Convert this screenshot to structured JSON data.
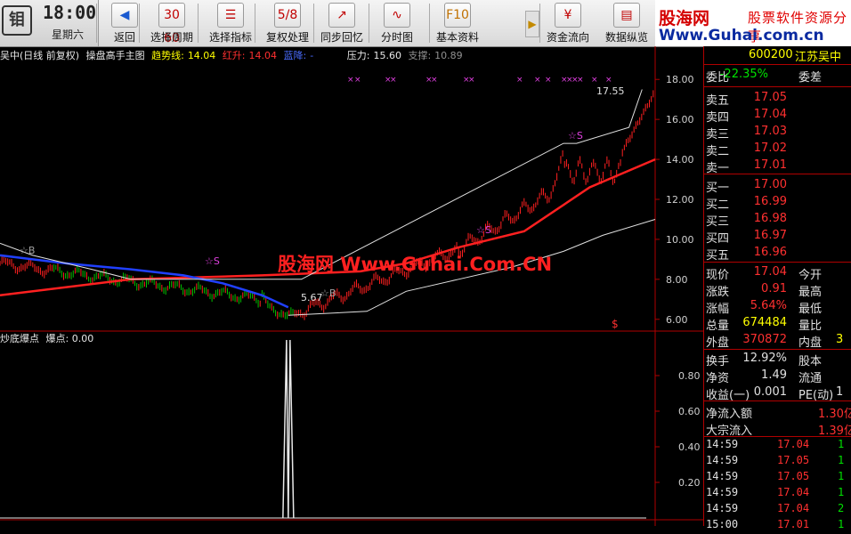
{
  "toolbar": {
    "clock_logo": "钼",
    "time": "18:00",
    "day": "星期六",
    "buttons": [
      {
        "label": "返回",
        "icon": "back-arrow-icon",
        "glyph": "◀"
      },
      {
        "label": "选择周期",
        "icon": "calendar-icon",
        "glyph": "30 60\n天"
      },
      {
        "label": "选择指标",
        "icon": "indicator-icon",
        "glyph": "☰"
      },
      {
        "label": "复权处理",
        "icon": "adjust-icon",
        "glyph": "5/8"
      },
      {
        "label": "同步回忆",
        "icon": "sync-chart-icon",
        "glyph": "↗"
      },
      {
        "label": "分时图",
        "icon": "intraday-icon",
        "glyph": "∿"
      },
      {
        "label": "基本资料",
        "icon": "f10-icon",
        "glyph": "F10"
      },
      {
        "label": "资金流向",
        "icon": "money-flow-icon",
        "glyph": "¥"
      },
      {
        "label": "数据纵览",
        "icon": "data-overview-icon",
        "glyph": "▤"
      }
    ]
  },
  "banner": {
    "title": "股海网",
    "slogan": "股票软件资源分享",
    "url": "Www.Guhai.com.cn"
  },
  "chart_header": {
    "name": "吴中(日线 前复权)",
    "indicator": "操盘高手主图",
    "trend_label": "趋势线:",
    "trend_value": "14.04",
    "red_label": "红升:",
    "red_value": "14.04",
    "blue_label": "蓝降:",
    "blue_value": "-",
    "press_label": "压力:",
    "press_value": "15.60",
    "support_label": "支撑:",
    "support_value": "10.89"
  },
  "watermark": "股海网 Www.Guhai.Com.CN",
  "annotations": {
    "high_price": "17.55",
    "low_price": "5.67",
    "signal_s": "☆S",
    "signal_b": "☆B",
    "dollar": "$"
  },
  "indicator_header": {
    "name": "炒底爆点",
    "label": "爆点:",
    "value": "0.00"
  },
  "chart_data": {
    "type": "line",
    "title": "",
    "main_axis": {
      "ticks": [
        "18.00",
        "16.00",
        "14.00",
        "12.00",
        "10.00",
        "8.00",
        "6.00"
      ],
      "ylim": [
        5.5,
        18.5
      ]
    },
    "sub_axis": {
      "ticks": [
        "0.80",
        "0.60",
        "0.40",
        "0.20"
      ],
      "ylim": [
        0,
        1
      ]
    },
    "series": [
      {
        "name": "趋势线",
        "color": "#ff2020",
        "x": [
          0,
          20,
          40,
          55,
          62,
          70,
          80,
          90,
          100
        ],
        "y": [
          7.2,
          8.0,
          8.2,
          8.4,
          8.8,
          9.6,
          10.4,
          12.6,
          14.0
        ]
      },
      {
        "name": "蓝降",
        "color": "#2040ff",
        "x": [
          0,
          10,
          20,
          28,
          34,
          40,
          44
        ],
        "y": [
          9.2,
          8.8,
          8.5,
          8.2,
          7.8,
          7.2,
          6.6
        ]
      },
      {
        "name": "压力",
        "color": "#e0e0e0",
        "x": [
          0,
          5,
          14,
          20,
          44,
          46,
          86,
          88,
          96,
          98
        ],
        "y": [
          9.8,
          9.2,
          8.5,
          8.0,
          8.0,
          8.0,
          14.8,
          14.8,
          15.6,
          17.5
        ]
      },
      {
        "name": "支撑",
        "color": "#e0e0e0",
        "x": [
          44,
          56,
          62,
          70,
          78,
          86,
          92,
          100
        ],
        "y": [
          6.2,
          6.4,
          7.4,
          8.0,
          8.6,
          9.4,
          10.2,
          11.0
        ]
      }
    ],
    "spike": {
      "x": 44,
      "value": 1.0
    }
  },
  "quote": {
    "code": "600200",
    "name": "江苏吴中",
    "ratio_label": "委比",
    "ratio_value": "-22.35%",
    "diff_label": "委差",
    "asks": [
      {
        "label": "卖五",
        "price": "17.05"
      },
      {
        "label": "卖四",
        "price": "17.04"
      },
      {
        "label": "卖三",
        "price": "17.03"
      },
      {
        "label": "卖二",
        "price": "17.02"
      },
      {
        "label": "卖一",
        "price": "17.01"
      }
    ],
    "bids": [
      {
        "label": "买一",
        "price": "17.00"
      },
      {
        "label": "买二",
        "price": "16.99"
      },
      {
        "label": "买三",
        "price": "16.98"
      },
      {
        "label": "买四",
        "price": "16.97"
      },
      {
        "label": "买五",
        "price": "16.96"
      }
    ],
    "stats": [
      {
        "a": "现价",
        "b": "17.04",
        "bc": "#ff3030",
        "c": "今开",
        "d": ""
      },
      {
        "a": "涨跌",
        "b": "0.91",
        "bc": "#ff3030",
        "c": "最高",
        "d": ""
      },
      {
        "a": "涨幅",
        "b": "5.64%",
        "bc": "#ff3030",
        "c": "最低",
        "d": ""
      },
      {
        "a": "总量",
        "b": "674484",
        "bc": "#ffff00",
        "c": "量比",
        "d": ""
      },
      {
        "a": "外盘",
        "b": "370872",
        "bc": "#ff3030",
        "c": "内盘",
        "d": "3"
      }
    ],
    "stats2": [
      {
        "a": "换手",
        "b": "12.92%",
        "bc": "#e0e0e0",
        "c": "股本",
        "d": ""
      },
      {
        "a": "净资",
        "b": "1.49",
        "bc": "#e0e0e0",
        "c": "流通",
        "d": ""
      },
      {
        "a": "收益(一)",
        "b": "0.001",
        "bc": "#e0e0e0",
        "c": "PE(动)",
        "d": "1"
      }
    ],
    "flows": [
      {
        "label": "净流入额",
        "value": "1.30亿"
      },
      {
        "label": "大宗流入",
        "value": "1.39亿"
      }
    ],
    "ticks": [
      {
        "t": "14:59",
        "p": "17.04",
        "v": "1"
      },
      {
        "t": "14:59",
        "p": "17.05",
        "v": "1"
      },
      {
        "t": "14:59",
        "p": "17.05",
        "v": "1"
      },
      {
        "t": "14:59",
        "p": "17.04",
        "v": "1"
      },
      {
        "t": "14:59",
        "p": "17.04",
        "v": "2"
      },
      {
        "t": "15:00",
        "p": "17.01",
        "v": "1"
      }
    ]
  }
}
